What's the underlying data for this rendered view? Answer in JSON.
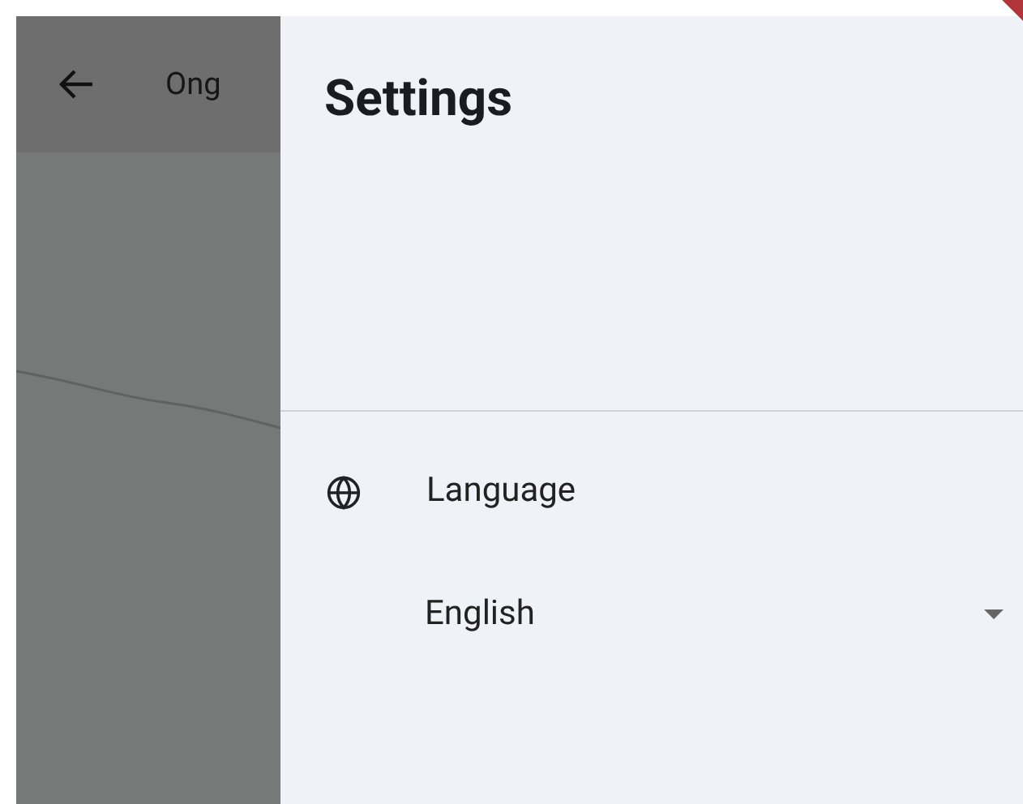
{
  "app_bar": {
    "title": "Ong"
  },
  "drawer": {
    "title": "Settings",
    "settings": [
      {
        "kind": "language",
        "label": "Language",
        "value": "English"
      }
    ]
  }
}
